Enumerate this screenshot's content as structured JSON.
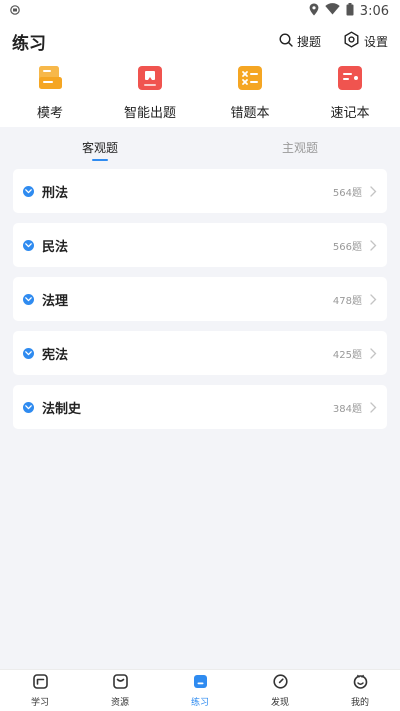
{
  "status_bar": {
    "time": "3:06"
  },
  "header": {
    "title": "练习",
    "search_label": "搜题",
    "settings_label": "设置"
  },
  "shortcuts": [
    {
      "label": "模考",
      "icon": "mock-exam-icon",
      "color": "#f5a623"
    },
    {
      "label": "智能出题",
      "icon": "smart-question-icon",
      "color": "#f0544f"
    },
    {
      "label": "错题本",
      "icon": "wrong-book-icon",
      "color": "#f5a623"
    },
    {
      "label": "速记本",
      "icon": "notebook-icon",
      "color": "#f0544f"
    }
  ],
  "tabs": [
    {
      "label": "客观题",
      "active": true
    },
    {
      "label": "主观题",
      "active": false
    }
  ],
  "subjects": [
    {
      "name": "刑法",
      "count": "564题"
    },
    {
      "name": "民法",
      "count": "566题"
    },
    {
      "name": "法理",
      "count": "478题"
    },
    {
      "name": "宪法",
      "count": "425题"
    },
    {
      "name": "法制史",
      "count": "384题"
    }
  ],
  "bottom_nav": [
    {
      "label": "学习",
      "active": false
    },
    {
      "label": "资源",
      "active": false
    },
    {
      "label": "练习",
      "active": true
    },
    {
      "label": "发现",
      "active": false
    },
    {
      "label": "我的",
      "active": false
    }
  ],
  "colors": {
    "accent": "#2f8bf0",
    "background": "#f3f4f8"
  }
}
